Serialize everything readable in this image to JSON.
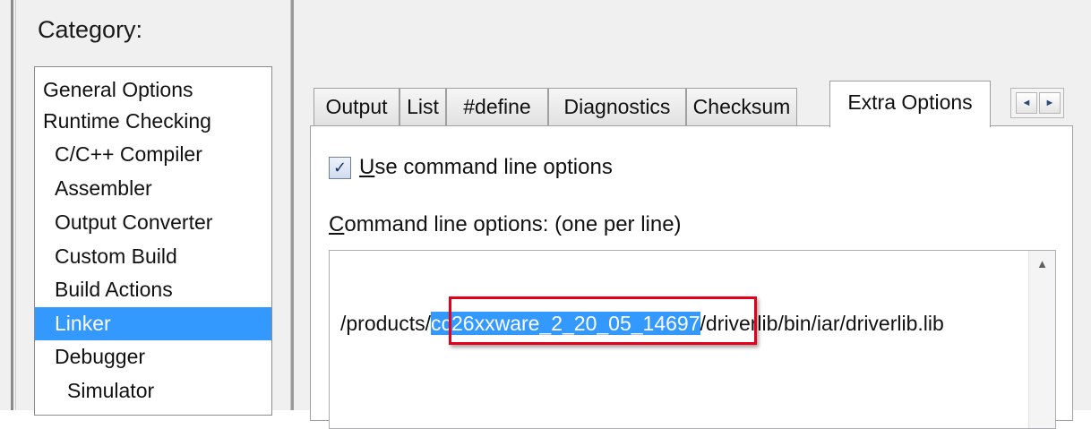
{
  "category_title": "Category:",
  "categories": [
    {
      "label": "General Options",
      "indent": 0,
      "selected": false
    },
    {
      "label": "Runtime Checking",
      "indent": 0,
      "selected": false
    },
    {
      "label": "C/C++ Compiler",
      "indent": 1,
      "selected": false
    },
    {
      "label": "Assembler",
      "indent": 1,
      "selected": false
    },
    {
      "label": "Output Converter",
      "indent": 1,
      "selected": false
    },
    {
      "label": "Custom Build",
      "indent": 1,
      "selected": false
    },
    {
      "label": "Build Actions",
      "indent": 1,
      "selected": false
    },
    {
      "label": "Linker",
      "indent": 1,
      "selected": true
    },
    {
      "label": "Debugger",
      "indent": 1,
      "selected": false
    },
    {
      "label": "Simulator",
      "indent": 2,
      "selected": false
    }
  ],
  "tabs": [
    {
      "label": "Output",
      "active": false
    },
    {
      "label": "List",
      "active": false
    },
    {
      "label": "#define",
      "active": false
    },
    {
      "label": "Diagnostics",
      "active": false
    },
    {
      "label": "Checksum",
      "active": false
    },
    {
      "label": "Extra Options",
      "active": true
    }
  ],
  "tab_scroll": {
    "left_icon": "◄",
    "right_icon": "►"
  },
  "extra_options": {
    "use_command_line": {
      "checked": true,
      "mnemonic": "U",
      "rest": "se command line options"
    },
    "command_line_label": {
      "mnemonic": "C",
      "rest": "ommand line options:  (one per line)"
    },
    "command_line": {
      "prefix": "/products/",
      "highlighted": "cc26xxware_2_20_05_14697",
      "suffix": "/driverlib/bin/iar/driverlib.lib"
    },
    "scroll_up_icon": "▲"
  },
  "colors": {
    "selection": "#3399ff",
    "annotation_box": "#e3001b"
  }
}
